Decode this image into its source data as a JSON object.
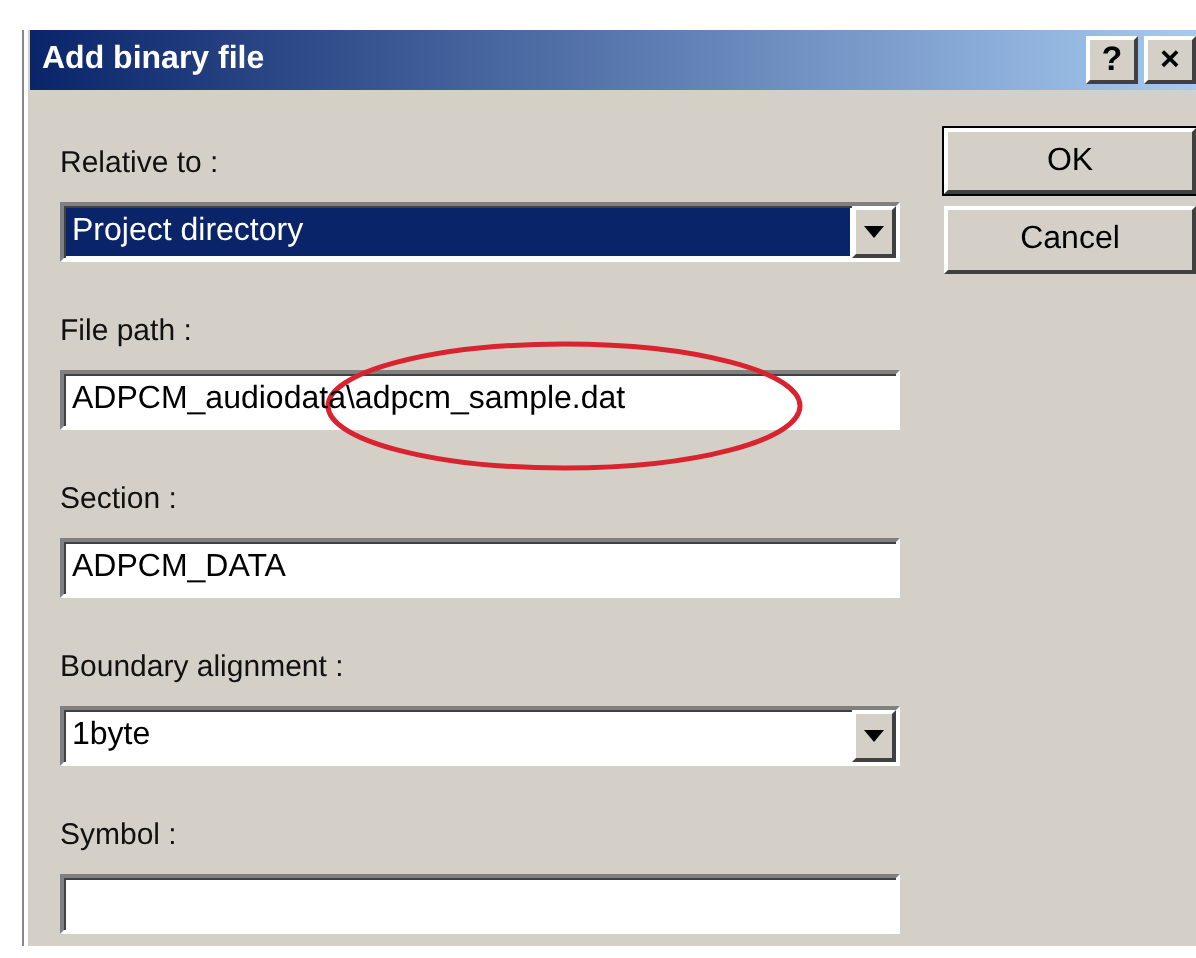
{
  "window": {
    "title": "Add binary file",
    "title_buttons": [
      "?",
      "×"
    ]
  },
  "fields": [
    {
      "label": "Relative to :",
      "kind": "combo",
      "value": "Project directory",
      "highlighted": true
    },
    {
      "label": "File path :",
      "kind": "text",
      "value": "ADPCM_audiodata\\adpcm_sample.dat",
      "highlighted": false
    },
    {
      "label": "Section :",
      "kind": "text",
      "value": "ADPCM_DATA",
      "highlighted": false
    },
    {
      "label": "Boundary alignment :",
      "kind": "combo",
      "value": "1byte",
      "highlighted": false
    },
    {
      "label": "Symbol :",
      "kind": "text",
      "highlighted": false
    }
  ],
  "buttons": [
    {
      "label": "OK",
      "default": true
    },
    {
      "label": "Cancel",
      "default": false
    }
  ],
  "annotation": {
    "kind": "ellipse"
  }
}
